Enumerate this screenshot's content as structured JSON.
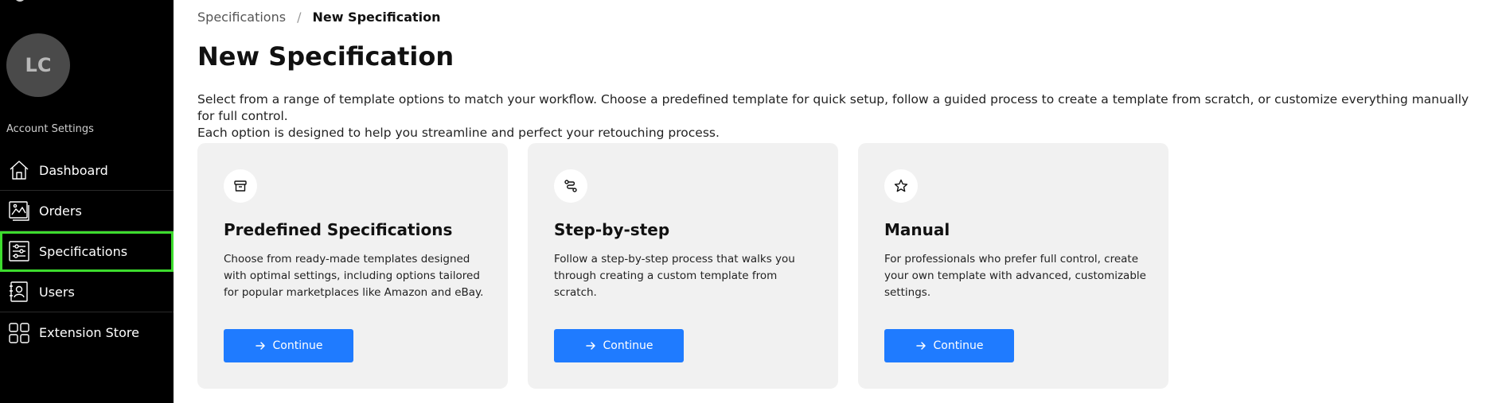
{
  "sidebar": {
    "avatar_initials": "LC",
    "account_label": "Account Settings",
    "items": [
      {
        "label": "Dashboard",
        "icon": "house-icon"
      },
      {
        "label": "Orders",
        "icon": "image-icon"
      },
      {
        "label": "Specifications",
        "icon": "sliders-icon",
        "active": true
      },
      {
        "label": "Users",
        "icon": "contact-book-icon"
      },
      {
        "label": "Extension Store",
        "icon": "grid-icon"
      }
    ]
  },
  "breadcrumb": {
    "parent": "Specifications",
    "separator": "/",
    "current": "New Specification"
  },
  "page": {
    "title": "New Specification",
    "intro_line1": "Select from a range of template options to match your workflow. Choose a predefined template for quick setup, follow a guided process to create a template from scratch, or customize everything manually for full control.",
    "intro_line2": "Each option is designed to help you streamline and perfect your retouching process."
  },
  "cards": [
    {
      "icon": "archive-icon",
      "title": "Predefined Specifications",
      "description": "Choose from ready-made templates designed with optimal settings, including options tailored for popular marketplaces like Amazon and eBay.",
      "button_label": "Continue"
    },
    {
      "icon": "route-icon",
      "title": "Step-by-step",
      "description": "Follow a step-by-step process that walks you through creating a custom template from scratch.",
      "button_label": "Continue"
    },
    {
      "icon": "star-icon",
      "title": "Manual",
      "description": "For professionals who prefer full control, create your own template with advanced, customizable settings.",
      "button_label": "Continue"
    }
  ],
  "colors": {
    "sidebar_bg": "#000000",
    "active_outline": "#3ddc2e",
    "button_bg": "#1f7bff",
    "card_bg": "#f1f1f1"
  }
}
